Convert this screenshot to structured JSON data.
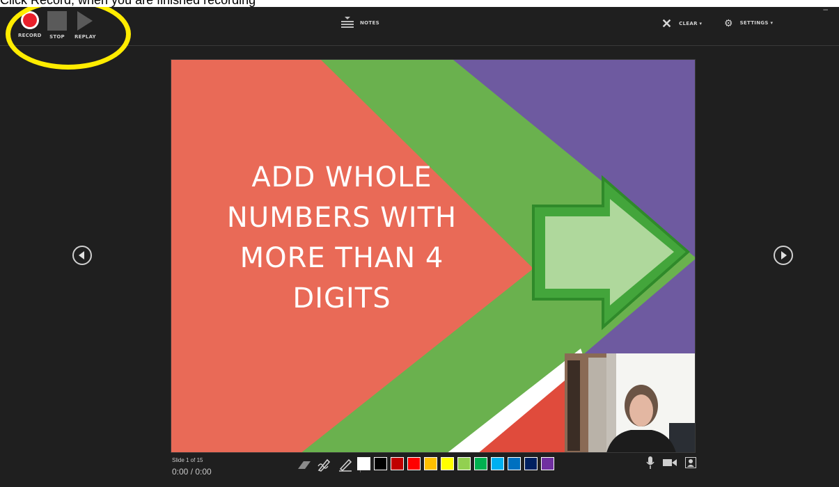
{
  "caption": "Click Record, when you are finished recording",
  "toolbar": {
    "record_label": "RECORD",
    "stop_label": "STOP",
    "replay_label": "REPLAY",
    "notes_label": "NOTES",
    "clear_label": "CLEAR ▾",
    "settings_label": "SETTINGS ▾"
  },
  "slide": {
    "title": "ADD WHOLE\nNUMBERS WITH\nMORE THAN 4\nDIGITS",
    "counter": "Slide 1 of 15",
    "time": "0:00 / 0:00"
  },
  "ink": {
    "tools": [
      "eraser-icon",
      "pen-icon",
      "highlighter-icon"
    ],
    "colors": [
      "#ffffff",
      "#000000",
      "#c00000",
      "#ff0000",
      "#ffc000",
      "#ffff00",
      "#92d050",
      "#00b050",
      "#00b0f0",
      "#0070c0",
      "#002060",
      "#7030a0"
    ]
  },
  "media": {
    "icons": [
      "microphone-icon",
      "camera-icon",
      "camera-preview-icon"
    ]
  },
  "colors": {
    "highlight_ring": "#ffec00",
    "slide_red": "#e96a57",
    "slide_green": "#6ab14e",
    "slide_purple": "#6e5aa0"
  }
}
